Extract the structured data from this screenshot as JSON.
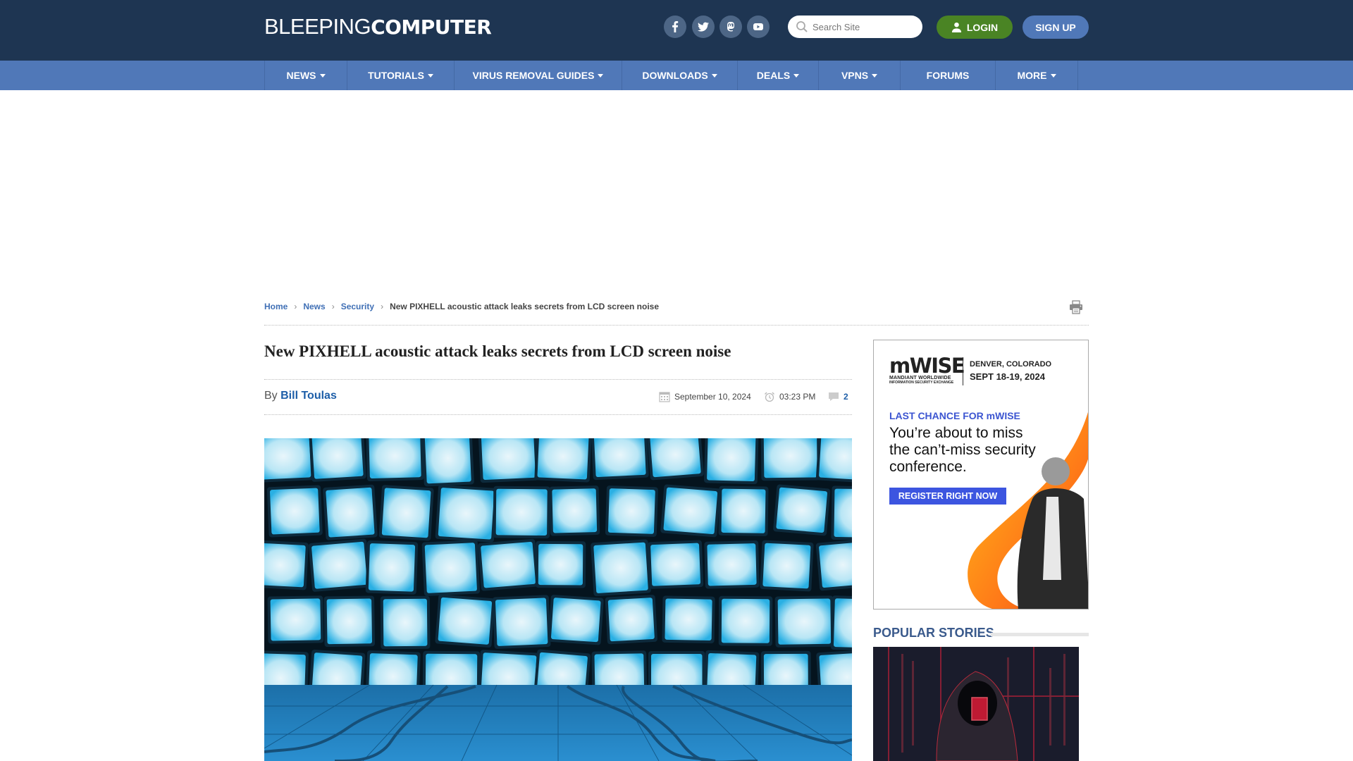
{
  "site": {
    "logo_light": "BLEEPING",
    "logo_bold": "COMPUTER"
  },
  "header": {
    "social": [
      {
        "name": "facebook",
        "icon": "facebook-icon"
      },
      {
        "name": "twitter",
        "icon": "twitter-icon"
      },
      {
        "name": "mastodon",
        "icon": "mastodon-icon"
      },
      {
        "name": "youtube",
        "icon": "youtube-icon"
      }
    ],
    "search_placeholder": "Search Site",
    "login_label": "LOGIN",
    "signup_label": "SIGN UP"
  },
  "nav": {
    "items": [
      {
        "label": "NEWS",
        "dropdown": true
      },
      {
        "label": "TUTORIALS",
        "dropdown": true
      },
      {
        "label": "VIRUS REMOVAL GUIDES",
        "dropdown": true
      },
      {
        "label": "DOWNLOADS",
        "dropdown": true
      },
      {
        "label": "DEALS",
        "dropdown": true
      },
      {
        "label": "VPNS",
        "dropdown": true
      },
      {
        "label": "FORUMS",
        "dropdown": false
      },
      {
        "label": "MORE",
        "dropdown": true
      }
    ]
  },
  "breadcrumb": {
    "items": [
      "Home",
      "News",
      "Security"
    ],
    "current": "New PIXHELL acoustic attack leaks secrets from LCD screen noise"
  },
  "article": {
    "title": "New PIXHELL acoustic attack leaks secrets from LCD screen noise",
    "by_label": "By",
    "author": "Bill Toulas",
    "date": "September 10, 2024",
    "time": "03:23 PM",
    "comments": "2",
    "hero_alt": "Wall of glowing blue TV screens"
  },
  "sidebar": {
    "ad": {
      "brand": "mWISE",
      "brand_sub1": "MANDIANT WORLDWIDE",
      "brand_sub2": "INFORMATION SECURITY EXCHANGE",
      "location": "DENVER, COLORADO",
      "dates": "SEPT 18-19, 2024",
      "kicker": "LAST CHANCE FOR mWISE",
      "headline": "You’re about to miss the can’t-miss security conference.",
      "cta": "REGISTER RIGHT NOW"
    },
    "popular_title": "POPULAR STORIES"
  },
  "colors": {
    "header_bg": "#1e3552",
    "nav_bg": "#5078b8",
    "login_green": "#4a8424",
    "signup_blue": "#5078b8",
    "link_blue": "#1d5ea8",
    "popular_title": "#3a5a8c"
  }
}
